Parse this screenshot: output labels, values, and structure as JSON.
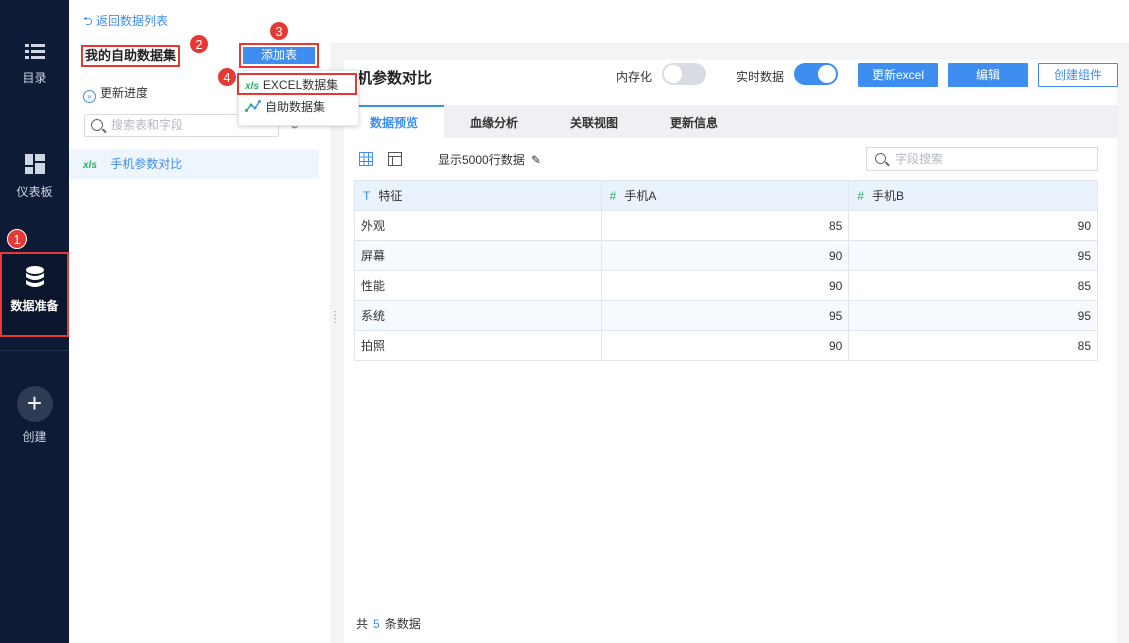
{
  "nav": {
    "items": [
      {
        "label": "目录",
        "icon": "list-icon"
      },
      {
        "label": "仪表板",
        "icon": "dashboard-icon"
      },
      {
        "label": "数据准备",
        "icon": "database-icon"
      },
      {
        "label": "创建",
        "icon": "plus-icon"
      }
    ]
  },
  "panel": {
    "back_label": "返回数据列表",
    "title": "我的自助数据集",
    "add_table_label": "添加表",
    "progress_label": "更新进度",
    "search_placeholder": "搜索表和字段",
    "tables": [
      {
        "name": "手机参数对比",
        "type_icon": "xls"
      }
    ]
  },
  "dropdown": {
    "items": [
      {
        "label": "EXCEL数据集",
        "icon": "xls"
      },
      {
        "label": "自助数据集",
        "icon": "self-service-dataset-icon"
      }
    ]
  },
  "markers": [
    "1",
    "2",
    "3",
    "4"
  ],
  "component": {
    "title": "机参数对比",
    "memory_label": "内存化",
    "memory_on": false,
    "realtime_label": "实时数据",
    "realtime_on": true,
    "update_excel_label": "更新excel",
    "edit_label": "编辑",
    "create_component_label": "创建组件"
  },
  "tabs": [
    {
      "label": "数据预览",
      "active": true
    },
    {
      "label": "血缘分析",
      "active": false
    },
    {
      "label": "关联视图",
      "active": false
    },
    {
      "label": "更新信息",
      "active": false
    }
  ],
  "toolbar": {
    "rowcount_label": "显示5000行数据",
    "field_search_placeholder": "字段搜索"
  },
  "table": {
    "columns": [
      {
        "type": "T",
        "name": "特征"
      },
      {
        "type": "#",
        "name": "手机A"
      },
      {
        "type": "#",
        "name": "手机B"
      }
    ],
    "rows": [
      [
        "外观",
        "85",
        "90"
      ],
      [
        "屏幕",
        "90",
        "95"
      ],
      [
        "性能",
        "90",
        "85"
      ],
      [
        "系统",
        "95",
        "95"
      ],
      [
        "拍照",
        "90",
        "85"
      ]
    ]
  },
  "footer": {
    "prefix": "共",
    "count": "5",
    "suffix": "条数据"
  },
  "colors": {
    "accent": "#3d8ef0",
    "nav_bg": "#0e1b36",
    "highlight": "#e53935",
    "xls": "#2bae66"
  }
}
